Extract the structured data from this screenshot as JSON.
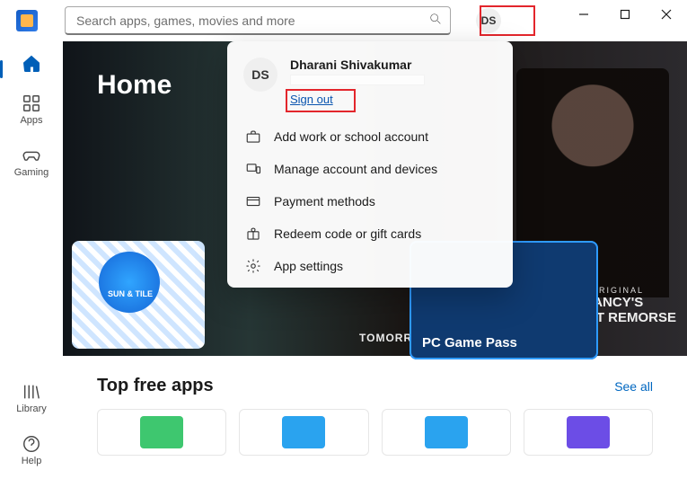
{
  "app": {
    "name": "Microsoft Store"
  },
  "search": {
    "placeholder": "Search apps, games, movies and more"
  },
  "avatar": {
    "initials": "DS"
  },
  "nav": {
    "home": "Home",
    "apps": "Apps",
    "gaming": "Gaming",
    "library": "Library",
    "help": "Help"
  },
  "hero": {
    "title": "Home",
    "card_text": "SUN & TILE",
    "caption1": "TOMORROW WAR",
    "big_card": "PC Game Pass",
    "right": {
      "line1": "AMAZON ORIGINAL",
      "line2": "TOM CLANCY'S",
      "line3": "WITHOUT REMORSE"
    }
  },
  "section": {
    "title": "Top free apps",
    "see_all": "See all"
  },
  "tile_colors": [
    "#3ec76f",
    "#2aa3ef",
    "#2aa3ef",
    "#6c4de6"
  ],
  "account_menu": {
    "initials": "DS",
    "name": "Dharani Shivakumar",
    "sign_out": "Sign out",
    "items": [
      "Add work or school account",
      "Manage account and devices",
      "Payment methods",
      "Redeem code or gift cards",
      "App settings"
    ]
  }
}
